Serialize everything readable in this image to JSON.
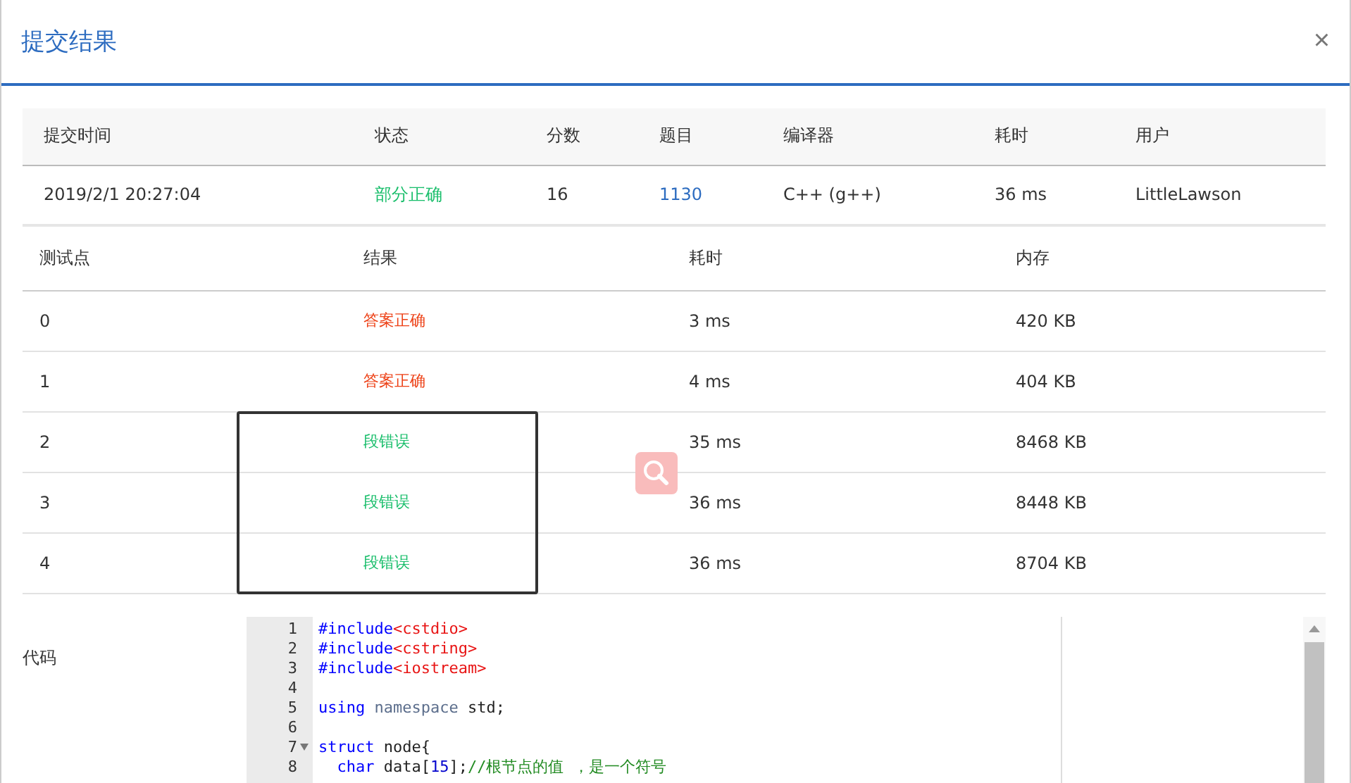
{
  "dialog": {
    "title": "提交结果",
    "close": "×"
  },
  "submission": {
    "columns": [
      "提交时间",
      "状态",
      "分数",
      "题目",
      "编译器",
      "耗时",
      "用户"
    ],
    "row": {
      "time": "2019/2/1 20:27:04",
      "status": "部分正确",
      "score": "16",
      "problem": "1130",
      "compiler": "C++ (g++)",
      "duration": "36 ms",
      "user": "LittleLawson"
    }
  },
  "tests": {
    "columns": [
      "测试点",
      "结果",
      "耗时",
      "内存"
    ],
    "rows": [
      {
        "id": "0",
        "result": "答案正确",
        "color": "#ed3f14",
        "time": "3 ms",
        "memory": "420 KB"
      },
      {
        "id": "1",
        "result": "答案正确",
        "color": "#ed3f14",
        "time": "4 ms",
        "memory": "404 KB"
      },
      {
        "id": "2",
        "result": "段错误",
        "color": "#19be6b",
        "time": "35 ms",
        "memory": "8468 KB"
      },
      {
        "id": "3",
        "result": "段错误",
        "color": "#19be6b",
        "time": "36 ms",
        "memory": "8448 KB"
      },
      {
        "id": "4",
        "result": "段错误",
        "color": "#19be6b",
        "time": "36 ms",
        "memory": "8704 KB"
      }
    ]
  },
  "code": {
    "label": "代码",
    "lines": [
      {
        "number": "1",
        "foldable": false,
        "indented": false,
        "tokens": [
          {
            "kind": "keyword",
            "text": "#include"
          },
          {
            "kind": "string",
            "text": "<cstdio>"
          }
        ]
      },
      {
        "number": "2",
        "foldable": false,
        "indented": false,
        "tokens": [
          {
            "kind": "keyword",
            "text": "#include"
          },
          {
            "kind": "string",
            "text": "<cstring>"
          }
        ]
      },
      {
        "number": "3",
        "foldable": false,
        "indented": false,
        "tokens": [
          {
            "kind": "keyword",
            "text": "#include"
          },
          {
            "kind": "string",
            "text": "<iostream>"
          }
        ]
      },
      {
        "number": "4",
        "foldable": false
      },
      {
        "number": "5",
        "foldable": false,
        "indented": false,
        "tokens": [
          {
            "kind": "keyword",
            "text": "using "
          },
          {
            "kind": "type",
            "text": "namespace "
          },
          {
            "kind": "plain",
            "text": "std;"
          }
        ]
      },
      {
        "number": "6",
        "foldable": false
      },
      {
        "number": "7",
        "foldable": true,
        "indented": false,
        "tokens": [
          {
            "kind": "keyword",
            "text": "struct"
          },
          {
            "kind": "plain",
            "text": " node{"
          }
        ]
      },
      {
        "number": "8",
        "foldable": false,
        "indented": true,
        "tokens": [
          {
            "kind": "keyword",
            "text": "char"
          },
          {
            "kind": "plain",
            "text": " data["
          },
          {
            "kind": "number",
            "text": "15"
          },
          {
            "kind": "plain",
            "text": "];"
          },
          {
            "kind": "comment",
            "text": "//根节点的值 ，是一个符号"
          }
        ]
      }
    ]
  }
}
